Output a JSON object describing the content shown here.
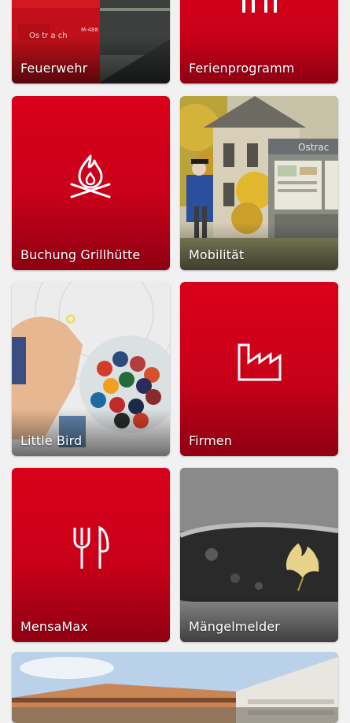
{
  "colors": {
    "primary_red": "#d9001b",
    "dark_red": "#8f0012",
    "background": "#f1f1f1",
    "label_text": "#ffffff"
  },
  "tiles": [
    {
      "label": "Feuerwehr",
      "icon": "fire-truck-photo"
    },
    {
      "label": "Ferienprogramm",
      "icon": "holiday-program-icon"
    },
    {
      "label": "Buchung Grillhütte",
      "icon": "campfire-icon"
    },
    {
      "label": "Mobilität",
      "icon": "bus-stop-photo",
      "sign_text": "Ostrac"
    },
    {
      "label": "Little Bird",
      "icon": "crayons-photo"
    },
    {
      "label": "Firmen",
      "icon": "factory-icon"
    },
    {
      "label": "MensaMax",
      "icon": "fork-knife-icon"
    },
    {
      "label": "Mängelmelder",
      "icon": "pothole-leaf-photo"
    },
    {
      "label": "",
      "icon": "school-building-photo"
    }
  ]
}
